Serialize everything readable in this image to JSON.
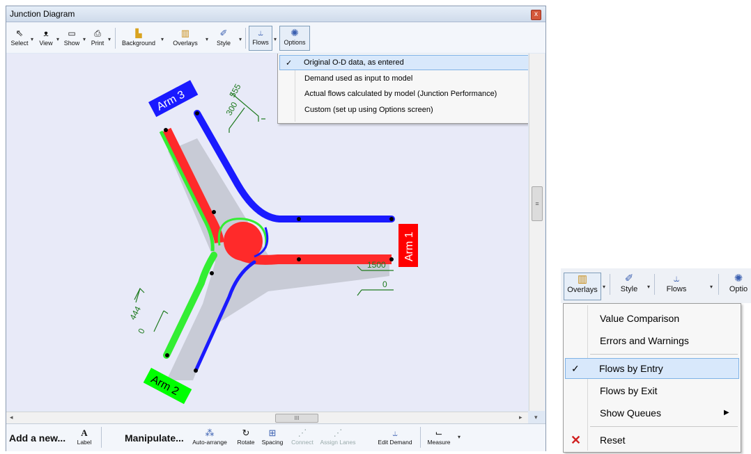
{
  "window": {
    "title": "Junction Diagram",
    "close_glyph": "x"
  },
  "toolbar": {
    "buttons": [
      {
        "label": "Select",
        "icon": "cursor-icon"
      },
      {
        "label": "View",
        "icon": "binoculars-icon"
      },
      {
        "label": "Show",
        "icon": "window-icon"
      },
      {
        "label": "Print",
        "icon": "printer-icon"
      },
      {
        "label": "Background",
        "icon": "background-icon"
      },
      {
        "label": "Overlays",
        "icon": "bar-chart-icon"
      },
      {
        "label": "Style",
        "icon": "brush-icon"
      },
      {
        "label": "Flows",
        "icon": "flows-icon"
      },
      {
        "label": "Options",
        "icon": "gear-icon"
      }
    ]
  },
  "flows_menu": {
    "items": [
      {
        "label": "Original O-D data, as entered",
        "checked": true
      },
      {
        "label": "Demand used as input to model",
        "checked": false
      },
      {
        "label": "Actual flows calculated by model (Junction Performance)",
        "checked": false
      },
      {
        "label": "Custom (set up using Options screen)",
        "checked": false
      }
    ],
    "check_glyph": "✓"
  },
  "diagram": {
    "arms": [
      {
        "label": "Arm 1",
        "color": "#ff0000"
      },
      {
        "label": "Arm 2",
        "color": "#00ff00"
      },
      {
        "label": "Arm 3",
        "color": "#0000ff"
      }
    ],
    "flow_labels": {
      "arm3_entry": "555",
      "arm3_exit": "300",
      "arm1_entry": "1500",
      "arm1_exit": "0",
      "arm2_entry": "444",
      "arm2_exit": "0"
    },
    "colors": {
      "blue": "#1a1aff",
      "red": "#ff2a2a",
      "green": "#33ee33",
      "road": "#c8cbd6",
      "label_green": "#1e7a1e"
    }
  },
  "scrollbar": {
    "grip": "≡",
    "h_grip": "III",
    "left_arrow": "◂",
    "right_arrow": "▸",
    "down_arrow": "▾"
  },
  "bottombar": {
    "add_heading": "Add a new...",
    "manipulate_heading": "Manipulate...",
    "buttons": [
      {
        "label": "Label",
        "icon": "text-a-icon",
        "enabled": true
      },
      {
        "label": "Auto-arrange",
        "icon": "auto-arrange-icon",
        "enabled": true
      },
      {
        "label": "Rotate",
        "icon": "rotate-icon",
        "enabled": true
      },
      {
        "label": "Spacing",
        "icon": "spacing-icon",
        "enabled": true
      },
      {
        "label": "Connect",
        "icon": "connect-icon",
        "enabled": false
      },
      {
        "label": "Assign Lanes",
        "icon": "assign-lanes-icon",
        "enabled": false
      },
      {
        "label": "Edit Demand",
        "icon": "edit-demand-icon",
        "enabled": true
      },
      {
        "label": "Measure",
        "icon": "ruler-icon",
        "enabled": true
      }
    ]
  },
  "overlays_menu": {
    "toolbar": [
      {
        "label": "Overlays"
      },
      {
        "label": "Style"
      },
      {
        "label": "Flows"
      },
      {
        "label": "Optio"
      }
    ],
    "items": [
      {
        "label": "Value Comparison",
        "checked": false
      },
      {
        "label": "Errors and Warnings",
        "checked": false
      },
      {
        "label": "Flows by Entry",
        "checked": true
      },
      {
        "label": "Flows by Exit",
        "checked": false
      },
      {
        "label": "Show Queues",
        "checked": false,
        "submenu": true
      },
      {
        "label": "Reset",
        "icon": "red-x-icon"
      }
    ],
    "submenu_glyph": "▶",
    "reset_glyph": "✕"
  }
}
